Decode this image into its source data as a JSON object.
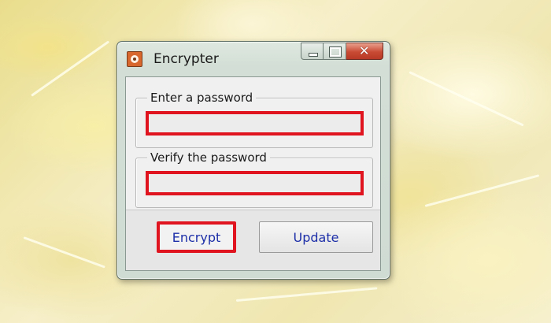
{
  "window": {
    "title": "Encrypter",
    "close_glyph": "✕"
  },
  "form": {
    "password_label": "Enter a password",
    "password_value": "",
    "verify_label": "Verify the password",
    "verify_value": ""
  },
  "buttons": {
    "encrypt_label": "Encrypt",
    "update_label": "Update"
  },
  "highlight_color": "#e0141e",
  "icons": {
    "app": "app-icon",
    "minimize": "minimize-icon",
    "maximize": "maximize-icon",
    "close": "close-icon"
  }
}
